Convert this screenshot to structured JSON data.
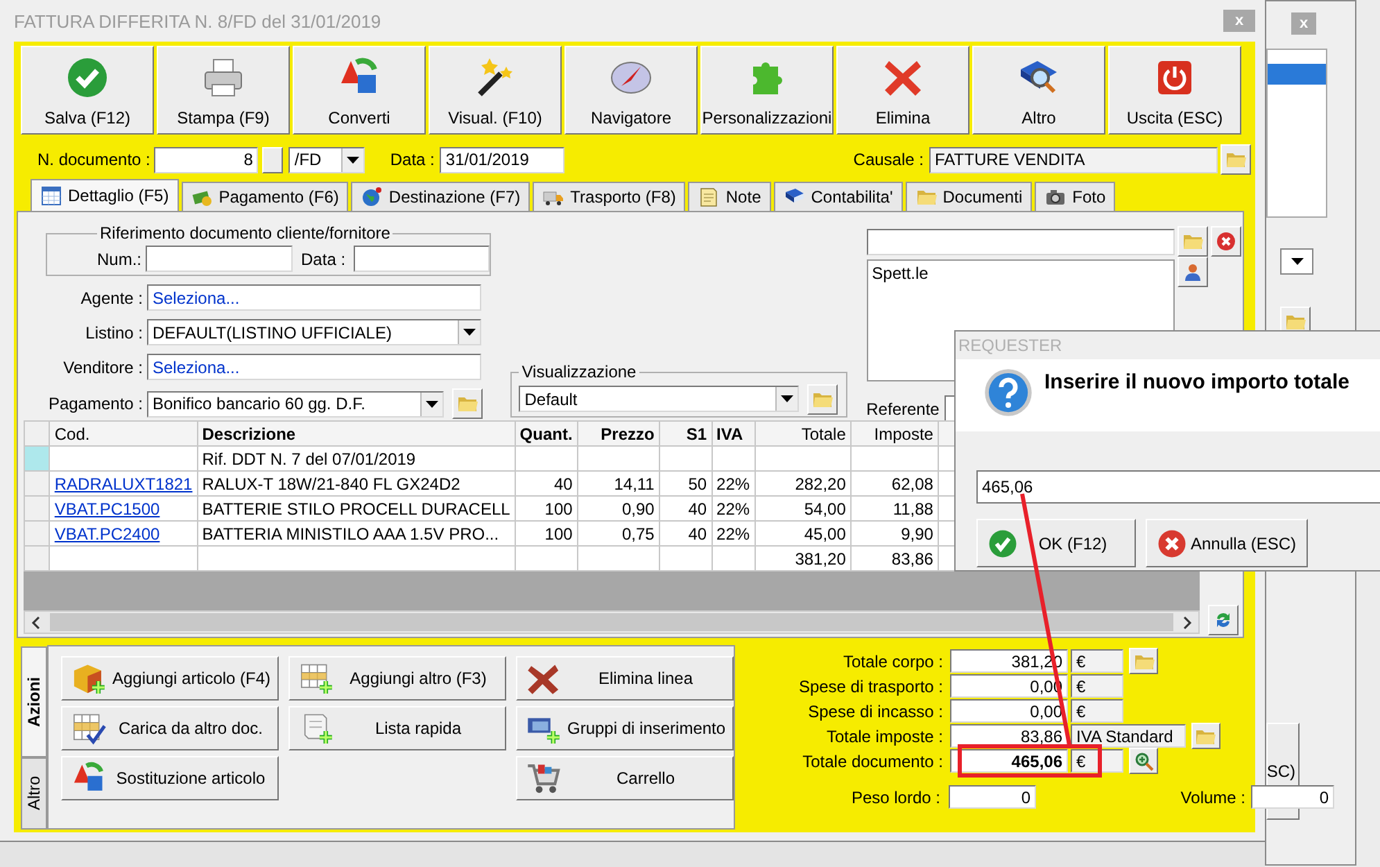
{
  "window": {
    "title": "FATTURA DIFFERITA N. 8/FD del 31/01/2019",
    "close": "x"
  },
  "toolbar": [
    {
      "label": "Salva (F12)"
    },
    {
      "label": "Stampa (F9)"
    },
    {
      "label": "Converti"
    },
    {
      "label": "Visual. (F10)"
    },
    {
      "label": "Navigatore"
    },
    {
      "label": "Personalizzazioni"
    },
    {
      "label": "Elimina"
    },
    {
      "label": "Altro"
    },
    {
      "label": "Uscita (ESC)"
    }
  ],
  "header": {
    "number_label": "N. documento :",
    "number": "8",
    "series": "/FD",
    "date_label": "Data :",
    "date": "31/01/2019",
    "reason_label": "Causale :",
    "reason": "FATTURE VENDITA"
  },
  "tabs": [
    {
      "label": "Dettaglio (F5)",
      "selected": true
    },
    {
      "label": "Pagamento (F6)",
      "selected": false
    },
    {
      "label": "Destinazione (F7)",
      "selected": false
    },
    {
      "label": "Trasporto (F8)",
      "selected": false
    },
    {
      "label": "Note",
      "selected": false
    },
    {
      "label": "Contabilita'",
      "selected": false
    },
    {
      "label": "Documenti",
      "selected": false
    },
    {
      "label": "Foto",
      "selected": false
    }
  ],
  "reference": {
    "legend": "Riferimento documento cliente/fornitore",
    "number_label": "Num.:",
    "date_label": "Data :"
  },
  "fields": [
    {
      "label": "Agente :",
      "value": "Seleziona...",
      "kind": "link"
    },
    {
      "label": "Listino :",
      "value": "DEFAULT(LISTINO UFFICIALE)",
      "kind": "select"
    },
    {
      "label": "Venditore :",
      "value": "Seleziona...",
      "kind": "link"
    },
    {
      "label": "Pagamento :",
      "value": "Bonifico bancario 60 gg. D.F.",
      "kind": "select_folder"
    }
  ],
  "view": {
    "legend": "Visualizzazione",
    "value": "Default"
  },
  "recipient": {
    "text": "Spett.le",
    "contact_label": "Referente"
  },
  "table": {
    "columns": [
      {
        "label": "Cod.",
        "bold": false,
        "kind": "link"
      },
      {
        "label": "Descrizione",
        "bold": true,
        "kind": "text"
      },
      {
        "label": "Quant.",
        "bold": true,
        "kind": "number"
      },
      {
        "label": "Prezzo",
        "bold": true,
        "kind": "number"
      },
      {
        "label": "S1",
        "bold": true,
        "kind": "number"
      },
      {
        "label": "IVA",
        "bold": true,
        "kind": "text"
      },
      {
        "label": "Totale",
        "bold": false,
        "kind": "number"
      },
      {
        "label": "Imposte",
        "bold": false,
        "kind": "number"
      }
    ],
    "rows": [
      {
        "selected": true,
        "cells": [
          null,
          "Rif. DDT N. 7 del 07/01/2019",
          null,
          null,
          null,
          null,
          null,
          null
        ]
      },
      {
        "selected": false,
        "cells": [
          "RADRALUXT1821",
          "RALUX-T 18W/21-840 FL GX24D2",
          "40",
          "14,11",
          "50",
          "22%",
          "282,20",
          "62,08"
        ]
      },
      {
        "selected": false,
        "cells": [
          "VBAT.PC1500",
          "BATTERIE STILO PROCELL DURACELL",
          "100",
          "0,90",
          "40",
          "22%",
          "54,00",
          "11,88"
        ]
      },
      {
        "selected": false,
        "cells": [
          "VBAT.PC2400",
          "BATTERIA MINISTILO AAA 1.5V PRO...",
          "100",
          "0,75",
          "40",
          "22%",
          "45,00",
          "9,90"
        ]
      },
      {
        "selected": false,
        "cells": [
          null,
          null,
          null,
          null,
          null,
          null,
          "381,20",
          "83,86"
        ]
      }
    ]
  },
  "actions": {
    "tabs": [
      {
        "label": "Azioni",
        "selected": true
      },
      {
        "label": "Altro",
        "selected": false
      }
    ],
    "columns": [
      [
        {
          "label": "Aggiungi articolo (F4)"
        },
        {
          "label": "Carica da altro doc."
        },
        {
          "label": "Sostituzione articolo"
        }
      ],
      [
        {
          "label": "Aggiungi altro (F3)"
        },
        {
          "label": "Lista rapida"
        }
      ],
      [
        {
          "label": "Elimina linea"
        },
        {
          "label": "Gruppi di inserimento"
        },
        {
          "label": "Carrello"
        }
      ]
    ]
  },
  "totals": [
    {
      "label": "Totale corpo :",
      "value": "381,20",
      "unit": "€",
      "emphasis": false
    },
    {
      "label": "Spese di trasporto :",
      "value": "0,00",
      "unit": "€",
      "emphasis": false
    },
    {
      "label": "Spese di incasso :",
      "value": "0,00",
      "unit": "€",
      "emphasis": false
    },
    {
      "label": "Totale imposte :",
      "value": "83,86",
      "unit": "IVA Standard",
      "emphasis": false
    },
    {
      "label": "Totale documento :",
      "value": "465,06",
      "unit": "€",
      "emphasis": true
    }
  ],
  "weights": {
    "gross_label": "Peso lordo :",
    "gross": "0",
    "volume_label": "Volume :",
    "volume": "0"
  },
  "dialog": {
    "title": "REQUESTER",
    "message": "Inserire il nuovo importo totale",
    "value": "465,06",
    "buttons": [
      {
        "label": "OK (F12)",
        "kind": "ok"
      },
      {
        "label": "Annulla (ESC)",
        "kind": "cancel"
      }
    ]
  },
  "background_window": {
    "close": "x",
    "button_text": "SC)"
  }
}
